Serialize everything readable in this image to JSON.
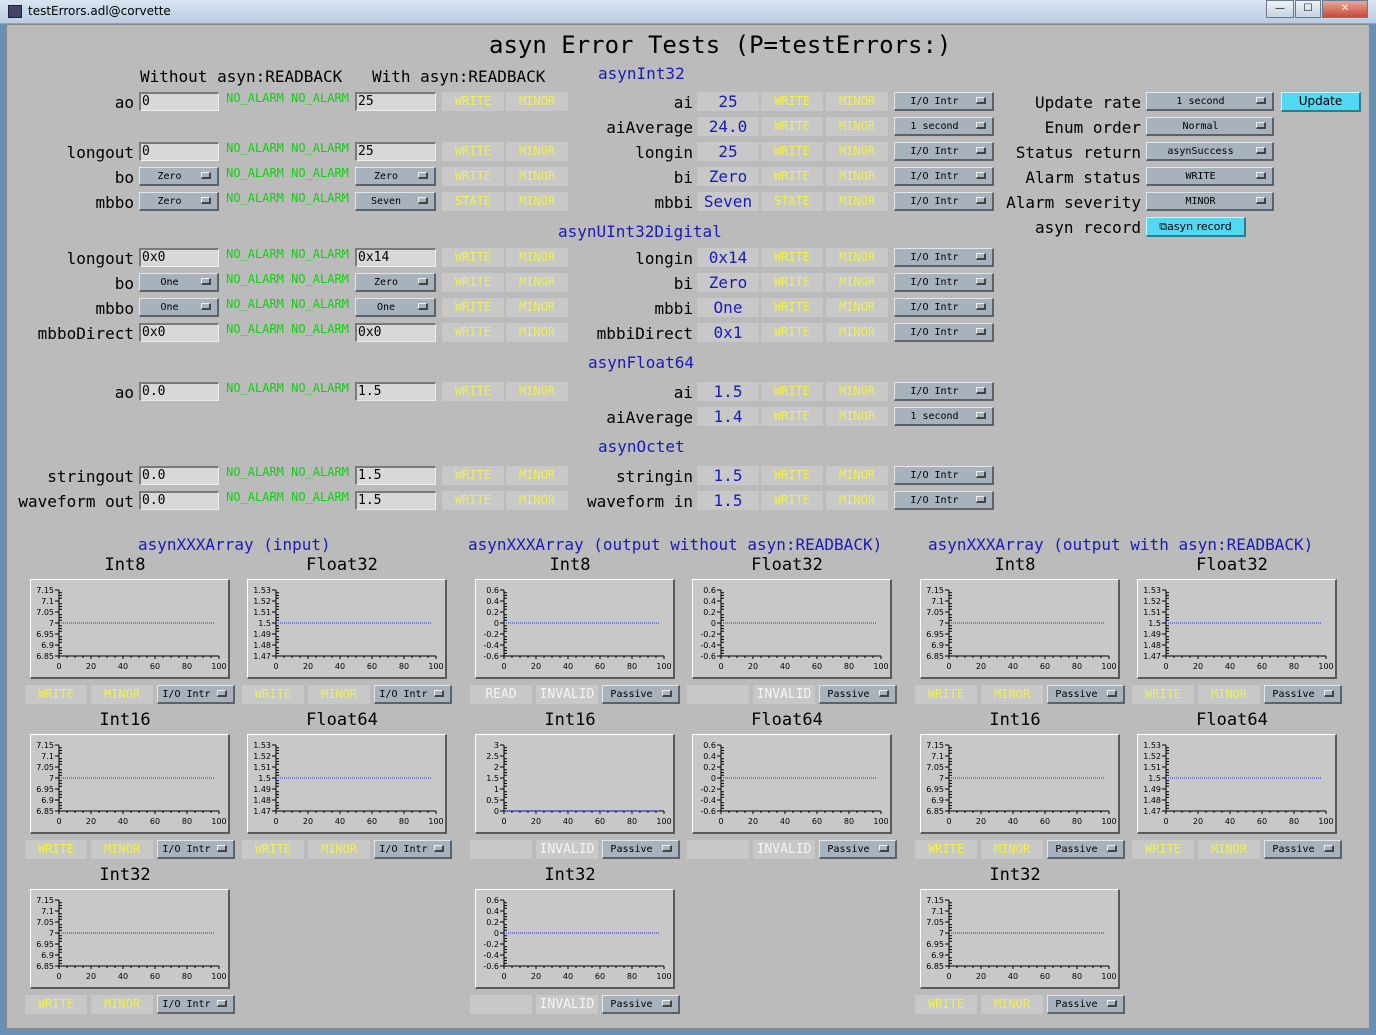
{
  "window": {
    "title": "testErrors.adl@corvette",
    "minimize_label": "—",
    "maximize_label": "☐",
    "close_label": "✕"
  },
  "page_title": "asyn Error Tests (P=testErrors:)",
  "headers": {
    "without_readback": "Without asyn:READBACK",
    "with_readback": "With asyn:READBACK"
  },
  "sections": {
    "int32": "asynInt32",
    "uint32": "asynUInt32Digital",
    "float64": "asynFloat64",
    "octet": "asynOctet"
  },
  "output_rows": [
    {
      "label": "ao",
      "top": 0,
      "entry": "0",
      "kind": "entry",
      "s1": "NO_ALARM",
      "s2": "NO_ALARM",
      "rb": "25",
      "rbkind": "entry",
      "w": "WRITE",
      "m": "MINOR"
    },
    {
      "label": "longout",
      "entry": "0",
      "kind": "entry",
      "s1": "NO_ALARM",
      "s2": "NO_ALARM",
      "rb": "25",
      "rbkind": "entry",
      "w": "WRITE",
      "m": "MINOR"
    },
    {
      "label": "bo",
      "entry": "Zero",
      "kind": "menu",
      "s1": "NO_ALARM",
      "s2": "NO_ALARM",
      "rb": "Zero",
      "rbkind": "menu",
      "w": "WRITE",
      "m": "MINOR"
    },
    {
      "label": "mbbo",
      "entry": "Zero",
      "kind": "menu",
      "s1": "NO_ALARM",
      "s2": "NO_ALARM",
      "rb": "Seven",
      "rbkind": "menu",
      "w": "STATE",
      "m": "MINOR"
    },
    {
      "label": "longout",
      "entry": "0x0",
      "kind": "entry",
      "s1": "NO_ALARM",
      "s2": "NO_ALARM",
      "rb": "0x14",
      "rbkind": "entry",
      "w": "WRITE",
      "m": "MINOR"
    },
    {
      "label": "bo",
      "entry": "One",
      "kind": "menu",
      "s1": "NO_ALARM",
      "s2": "NO_ALARM",
      "rb": "Zero",
      "rbkind": "menu",
      "w": "WRITE",
      "m": "MINOR"
    },
    {
      "label": "mbbo",
      "entry": "One",
      "kind": "menu",
      "s1": "NO_ALARM",
      "s2": "NO_ALARM",
      "rb": "One",
      "rbkind": "menu",
      "w": "WRITE",
      "m": "MINOR"
    },
    {
      "label": "mbboDirect",
      "entry": "0x0",
      "kind": "entry",
      "s1": "NO_ALARM",
      "s2": "NO_ALARM",
      "rb": "0x0",
      "rbkind": "entry",
      "w": "WRITE",
      "m": "MINOR"
    },
    {
      "label": "ao",
      "entry": "0.0",
      "kind": "entry",
      "s1": "NO_ALARM",
      "s2": "NO_ALARM",
      "rb": "1.5",
      "rbkind": "entry",
      "w": "WRITE",
      "m": "MINOR"
    },
    {
      "label": "stringout",
      "entry": "0.0",
      "kind": "entry",
      "s1": "NO_ALARM",
      "s2": "NO_ALARM",
      "rb": "1.5",
      "rbkind": "entry",
      "w": "WRITE",
      "m": "MINOR"
    },
    {
      "label": "waveform out",
      "entry": "0.0",
      "kind": "entry",
      "s1": "NO_ALARM",
      "s2": "NO_ALARM",
      "rb": "1.5",
      "rbkind": "entry",
      "w": "WRITE",
      "m": "MINOR"
    }
  ],
  "input_rows": [
    {
      "label": "ai",
      "val": "25",
      "w": "WRITE",
      "m": "MINOR",
      "scan": "I/O Intr"
    },
    {
      "label": "aiAverage",
      "val": "24.0",
      "w": "WRITE",
      "m": "MINOR",
      "scan": "1 second"
    },
    {
      "label": "longin",
      "val": "25",
      "w": "WRITE",
      "m": "MINOR",
      "scan": "I/O Intr"
    },
    {
      "label": "bi",
      "val": "Zero",
      "w": "WRITE",
      "m": "MINOR",
      "scan": "I/O Intr"
    },
    {
      "label": "mbbi",
      "val": "Seven",
      "w": "STATE",
      "m": "MINOR",
      "scan": "I/O Intr"
    },
    {
      "label": "longin",
      "val": "0x14",
      "w": "WRITE",
      "m": "MINOR",
      "scan": "I/O Intr"
    },
    {
      "label": "bi",
      "val": "Zero",
      "w": "WRITE",
      "m": "MINOR",
      "scan": "I/O Intr"
    },
    {
      "label": "mbbi",
      "val": "One",
      "w": "WRITE",
      "m": "MINOR",
      "scan": "I/O Intr"
    },
    {
      "label": "mbbiDirect",
      "val": "0x1",
      "w": "WRITE",
      "m": "MINOR",
      "scan": "I/O Intr"
    },
    {
      "label": "ai",
      "val": "1.5",
      "w": "WRITE",
      "m": "MINOR",
      "scan": "I/O Intr"
    },
    {
      "label": "aiAverage",
      "val": "1.4",
      "w": "WRITE",
      "m": "MINOR",
      "scan": "1 second"
    },
    {
      "label": "stringin",
      "val": "1.5",
      "w": "WRITE",
      "m": "MINOR",
      "scan": "I/O Intr"
    },
    {
      "label": "waveform in",
      "val": "1.5",
      "w": "WRITE",
      "m": "MINOR",
      "scan": "I/O Intr"
    }
  ],
  "controls": {
    "update_rate_label": "Update rate",
    "update_rate_value": "1 second",
    "update_button": "Update",
    "enum_order_label": "Enum order",
    "enum_order_value": "Normal",
    "status_return_label": "Status return",
    "status_return_value": "asynSuccess",
    "alarm_status_label": "Alarm status",
    "alarm_status_value": "WRITE",
    "alarm_severity_label": "Alarm severity",
    "alarm_severity_value": "MINOR",
    "asyn_record_label": "asyn record",
    "asyn_record_button": "asyn record",
    "asyn_record_icon": "window-icon"
  },
  "array_sections": {
    "input": "asynXXXArray (input)",
    "out_no_rb": "asynXXXArray (output without asyn:READBACK)",
    "out_rb": "asynXXXArray (output with asyn:READBACK)"
  },
  "plots": [
    {
      "group": 0,
      "col": 0,
      "row": 0,
      "title": "Int8",
      "yticks": [
        "7.15",
        "7.1",
        "7.05",
        "7",
        "6.95",
        "6.9",
        "6.85"
      ],
      "y": 7,
      "ymin": 6.85,
      "ymax": 7.15,
      "s1": "WRITE",
      "s1c": "yellow",
      "s2": "MINOR",
      "s2c": "yellow",
      "scan": "I/O Intr"
    },
    {
      "group": 0,
      "col": 1,
      "row": 0,
      "title": "Float32",
      "yticks": [
        "1.53",
        "1.52",
        "1.51",
        "1.5",
        "1.49",
        "1.48",
        "1.47"
      ],
      "y": 1.5,
      "ymin": 1.47,
      "ymax": 1.53,
      "s1": "WRITE",
      "s1c": "yellow",
      "s2": "MINOR",
      "s2c": "yellow",
      "scan": "I/O Intr"
    },
    {
      "group": 0,
      "col": 0,
      "row": 1,
      "title": "Int16",
      "yticks": [
        "7.15",
        "7.1",
        "7.05",
        "7",
        "6.95",
        "6.9",
        "6.85"
      ],
      "y": 7,
      "ymin": 6.85,
      "ymax": 7.15,
      "s1": "WRITE",
      "s1c": "yellow",
      "s2": "MINOR",
      "s2c": "yellow",
      "scan": "I/O Intr"
    },
    {
      "group": 0,
      "col": 1,
      "row": 1,
      "title": "Float64",
      "yticks": [
        "1.53",
        "1.52",
        "1.51",
        "1.5",
        "1.49",
        "1.48",
        "1.47"
      ],
      "y": 1.5,
      "ymin": 1.47,
      "ymax": 1.53,
      "s1": "WRITE",
      "s1c": "yellow",
      "s2": "MINOR",
      "s2c": "yellow",
      "scan": "I/O Intr"
    },
    {
      "group": 0,
      "col": 0,
      "row": 2,
      "title": "Int32",
      "yticks": [
        "7.15",
        "7.1",
        "7.05",
        "7",
        "6.95",
        "6.9",
        "6.85"
      ],
      "y": 7,
      "ymin": 6.85,
      "ymax": 7.15,
      "s1": "WRITE",
      "s1c": "yellow",
      "s2": "MINOR",
      "s2c": "yellow",
      "scan": "I/O Intr"
    },
    {
      "group": 1,
      "col": 0,
      "row": 0,
      "title": "Int8",
      "yticks": [
        "0.6",
        "0.4",
        "0.2",
        "0",
        "-0.2",
        "-0.4",
        "-0.6"
      ],
      "y": 0,
      "ymin": -0.6,
      "ymax": 0.6,
      "s1": "READ",
      "s1c": "white",
      "s2": "INVALID",
      "s2c": "white",
      "scan": "Passive"
    },
    {
      "group": 1,
      "col": 1,
      "row": 0,
      "title": "Float32",
      "yticks": [
        "0.6",
        "0.4",
        "0.2",
        "0",
        "-0.2",
        "-0.4",
        "-0.6"
      ],
      "y": 0,
      "ymin": -0.6,
      "ymax": 0.6,
      "s1": "",
      "s1c": "white",
      "s2": "INVALID",
      "s2c": "white",
      "scan": "Passive"
    },
    {
      "group": 1,
      "col": 0,
      "row": 1,
      "title": "Int16",
      "yticks": [
        "3",
        "2.5",
        "2",
        "1.5",
        "1",
        "0.5",
        "0"
      ],
      "y": 0,
      "ymin": 0,
      "ymax": 3,
      "s1": "",
      "s1c": "white",
      "s2": "INVALID",
      "s2c": "white",
      "scan": "Passive"
    },
    {
      "group": 1,
      "col": 1,
      "row": 1,
      "title": "Float64",
      "yticks": [
        "0.6",
        "0.4",
        "0.2",
        "0",
        "-0.2",
        "-0.4",
        "-0.6"
      ],
      "y": 0,
      "ymin": -0.6,
      "ymax": 0.6,
      "s1": "",
      "s1c": "white",
      "s2": "INVALID",
      "s2c": "white",
      "scan": "Passive"
    },
    {
      "group": 1,
      "col": 0,
      "row": 2,
      "title": "Int32",
      "yticks": [
        "0.6",
        "0.4",
        "0.2",
        "0",
        "-0.2",
        "-0.4",
        "-0.6"
      ],
      "y": 0,
      "ymin": -0.6,
      "ymax": 0.6,
      "s1": "",
      "s1c": "white",
      "s2": "INVALID",
      "s2c": "white",
      "scan": "Passive"
    },
    {
      "group": 2,
      "col": 0,
      "row": 0,
      "title": "Int8",
      "yticks": [
        "7.15",
        "7.1",
        "7.05",
        "7",
        "6.95",
        "6.9",
        "6.85"
      ],
      "y": 7,
      "ymin": 6.85,
      "ymax": 7.15,
      "s1": "WRITE",
      "s1c": "yellow",
      "s2": "MINOR",
      "s2c": "yellow",
      "scan": "Passive"
    },
    {
      "group": 2,
      "col": 1,
      "row": 0,
      "title": "Float32",
      "yticks": [
        "1.53",
        "1.52",
        "1.51",
        "1.5",
        "1.49",
        "1.48",
        "1.47"
      ],
      "y": 1.5,
      "ymin": 1.47,
      "ymax": 1.53,
      "s1": "WRITE",
      "s1c": "yellow",
      "s2": "MINOR",
      "s2c": "yellow",
      "scan": "Passive"
    },
    {
      "group": 2,
      "col": 0,
      "row": 1,
      "title": "Int16",
      "yticks": [
        "7.15",
        "7.1",
        "7.05",
        "7",
        "6.95",
        "6.9",
        "6.85"
      ],
      "y": 7,
      "ymin": 6.85,
      "ymax": 7.15,
      "s1": "WRITE",
      "s1c": "yellow",
      "s2": "MINOR",
      "s2c": "yellow",
      "scan": "Passive"
    },
    {
      "group": 2,
      "col": 1,
      "row": 1,
      "title": "Float64",
      "yticks": [
        "1.53",
        "1.52",
        "1.51",
        "1.5",
        "1.49",
        "1.48",
        "1.47"
      ],
      "y": 1.5,
      "ymin": 1.47,
      "ymax": 1.53,
      "s1": "WRITE",
      "s1c": "yellow",
      "s2": "MINOR",
      "s2c": "yellow",
      "scan": "Passive"
    },
    {
      "group": 2,
      "col": 0,
      "row": 2,
      "title": "Int32",
      "yticks": [
        "7.15",
        "7.1",
        "7.05",
        "7",
        "6.95",
        "6.9",
        "6.85"
      ],
      "y": 7,
      "ymin": 6.85,
      "ymax": 7.15,
      "s1": "WRITE",
      "s1c": "yellow",
      "s2": "MINOR",
      "s2c": "yellow",
      "scan": "Passive"
    }
  ],
  "xticks": [
    "0",
    "20",
    "40",
    "60",
    "80",
    "100"
  ],
  "colors": {
    "background": "#bbbbbb",
    "section_blue": "#1a1ab8",
    "no_alarm_green": "#10d010",
    "minor_yellow": "#f0f050",
    "invalid_white": "#f5f5f5",
    "plot_line": "#2233dd",
    "update_button": "#52d8f2"
  }
}
